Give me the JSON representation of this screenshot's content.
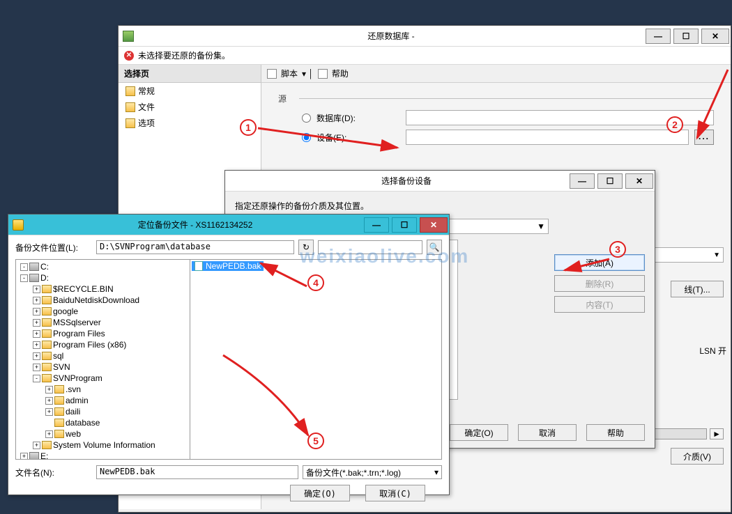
{
  "restore": {
    "title": "还原数据库 -",
    "warning": "未选择要还原的备份集。",
    "leftnav_header": "选择页",
    "leftnav": [
      "常规",
      "文件",
      "选项"
    ],
    "toolbar": {
      "script": "脚本",
      "help": "帮助"
    },
    "group_source": "源",
    "radio_database": "数据库(D):",
    "radio_device": "设备(E):",
    "button_timeline": "线(T)...",
    "lsn_header": "LSN  开",
    "button_verify": "介质(V)"
  },
  "device": {
    "title": "选择备份设备",
    "instruction": "指定还原操作的备份介质及其位置。",
    "btn_add": "添加(A)",
    "btn_remove": "删除(R)",
    "btn_content": "内容(T)",
    "btn_ok": "确定(O)",
    "btn_cancel": "取消",
    "btn_help": "帮助"
  },
  "locate": {
    "title": "定位备份文件 - XS1162134252",
    "loc_label": "备份文件位置(L):",
    "path": "D:\\SVNProgram\\database",
    "selected_file": "NewPEDB.bak",
    "filename_label": "文件名(N):",
    "filename": "NewPEDB.bak",
    "filetype": "备份文件(*.bak;*.trn;*.log)",
    "btn_ok": "确定(O)",
    "btn_cancel": "取消(C)",
    "tree": [
      {
        "depth": 0,
        "exp": "-",
        "drive": true,
        "label": "C:"
      },
      {
        "depth": 0,
        "exp": "-",
        "drive": true,
        "label": "D:"
      },
      {
        "depth": 1,
        "exp": "+",
        "label": "$RECYCLE.BIN"
      },
      {
        "depth": 1,
        "exp": "+",
        "label": "BaiduNetdiskDownload"
      },
      {
        "depth": 1,
        "exp": "+",
        "label": "google"
      },
      {
        "depth": 1,
        "exp": "+",
        "label": "MSSqlserver"
      },
      {
        "depth": 1,
        "exp": "+",
        "label": "Program Files"
      },
      {
        "depth": 1,
        "exp": "+",
        "label": "Program Files (x86)"
      },
      {
        "depth": 1,
        "exp": "+",
        "label": "sql"
      },
      {
        "depth": 1,
        "exp": "+",
        "label": "SVN"
      },
      {
        "depth": 1,
        "exp": "-",
        "label": "SVNProgram"
      },
      {
        "depth": 2,
        "exp": "+",
        "label": ".svn"
      },
      {
        "depth": 2,
        "exp": "+",
        "label": "admin"
      },
      {
        "depth": 2,
        "exp": "+",
        "label": "daili"
      },
      {
        "depth": 2,
        "exp": "",
        "label": "database"
      },
      {
        "depth": 2,
        "exp": "+",
        "label": "web"
      },
      {
        "depth": 1,
        "exp": "+",
        "label": "System Volume Information"
      },
      {
        "depth": 0,
        "exp": "+",
        "drive": true,
        "label": "E:"
      }
    ]
  },
  "annotations": {
    "1": "1",
    "2": "2",
    "3": "3",
    "4": "4",
    "5": "5"
  },
  "watermark": "weixiaolive.com",
  "chart_data": {
    "type": "table",
    "note": "no chart in image"
  }
}
